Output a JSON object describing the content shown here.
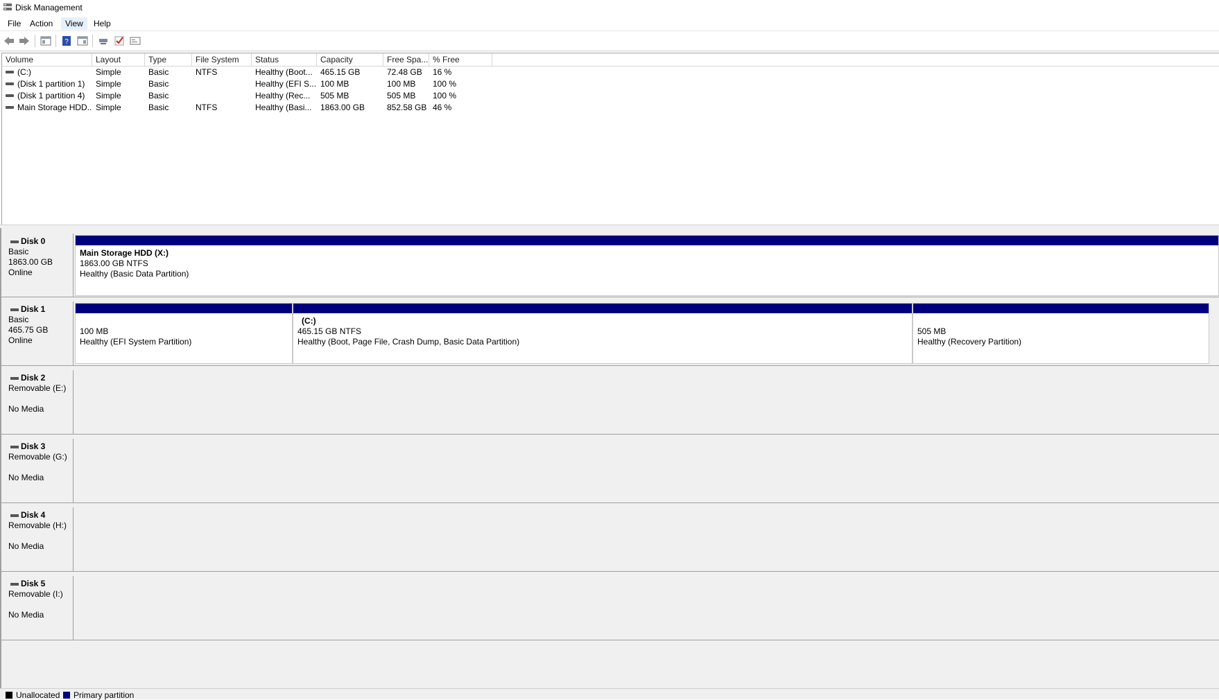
{
  "window": {
    "title": "Disk Management"
  },
  "menu": [
    "File",
    "Action",
    "View",
    "Help"
  ],
  "toolbar_icons": [
    "back-arrow-icon",
    "forward-arrow-icon",
    "console-tree-icon",
    "help-icon",
    "properties-icon",
    "connect-icon",
    "checkmark-icon",
    "rescan-icon"
  ],
  "volume_list": {
    "columns": [
      "Volume",
      "Layout",
      "Type",
      "File System",
      "Status",
      "Capacity",
      "Free Spa...",
      "% Free"
    ],
    "rows": [
      [
        "(C:)",
        "Simple",
        "Basic",
        "NTFS",
        "Healthy (Boot...",
        "465.15 GB",
        "72.48 GB",
        "16 %"
      ],
      [
        "(Disk 1 partition 1)",
        "Simple",
        "Basic",
        "",
        "Healthy (EFI S...",
        "100 MB",
        "100 MB",
        "100 %"
      ],
      [
        "(Disk 1 partition 4)",
        "Simple",
        "Basic",
        "",
        "Healthy (Rec...",
        "505 MB",
        "505 MB",
        "100 %"
      ],
      [
        "Main Storage HDD...",
        "Simple",
        "Basic",
        "NTFS",
        "Healthy (Basi...",
        "1863.00 GB",
        "852.58 GB",
        "46 %"
      ]
    ]
  },
  "disks": [
    {
      "name": "Disk 0",
      "line2": "Basic",
      "line3": "1863.00 GB",
      "line4": "Online",
      "partitions": [
        {
          "title": "Main Storage HDD  (X:)",
          "size": "1863.00 GB NTFS",
          "status": "Healthy (Basic Data Partition)"
        }
      ]
    },
    {
      "name": "Disk 1",
      "line2": "Basic",
      "line3": "465.75 GB",
      "line4": "Online",
      "partitions": [
        {
          "title": "",
          "size": "100 MB",
          "status": "Healthy (EFI System Partition)"
        },
        {
          "title": "(C:)",
          "size": "465.15 GB NTFS",
          "status": "Healthy (Boot, Page File, Crash Dump, Basic Data Partition)"
        },
        {
          "title": "",
          "size": "505 MB",
          "status": "Healthy (Recovery Partition)"
        }
      ]
    },
    {
      "name": "Disk 2",
      "line2": "Removable (E:)",
      "line3": "",
      "line4": "No Media",
      "partitions": []
    },
    {
      "name": "Disk 3",
      "line2": "Removable (G:)",
      "line3": "",
      "line4": "No Media",
      "partitions": []
    },
    {
      "name": "Disk 4",
      "line2": "Removable (H:)",
      "line3": "",
      "line4": "No Media",
      "partitions": []
    },
    {
      "name": "Disk 5",
      "line2": "Removable (I:)",
      "line3": "",
      "line4": "No Media",
      "partitions": []
    }
  ],
  "legend": [
    {
      "label": "Unallocated",
      "color": "#000000"
    },
    {
      "label": "Primary partition",
      "color": "#00007f"
    }
  ],
  "colors": {
    "primary_partition": "#00007f",
    "unallocated": "#000000"
  }
}
